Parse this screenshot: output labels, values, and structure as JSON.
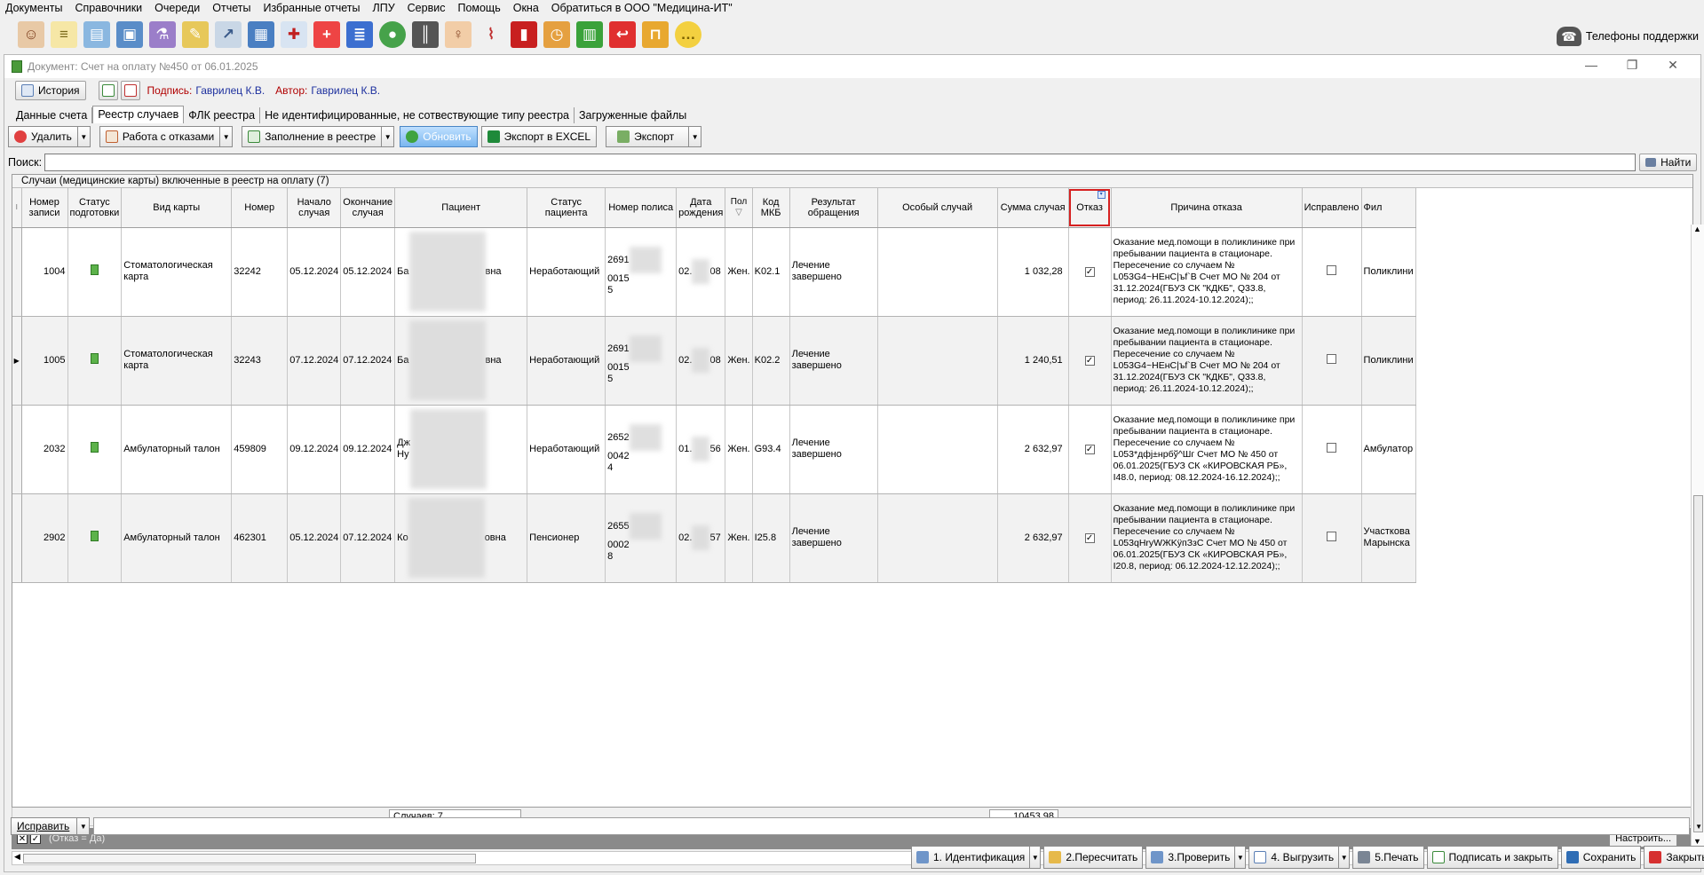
{
  "menu": [
    "Документы",
    "Справочники",
    "Очереди",
    "Отчеты",
    "Избранные отчеты",
    "ЛПУ",
    "Сервис",
    "Помощь",
    "Окна",
    "Обратиться в ООО \"Медицина-ИТ\""
  ],
  "toolbar": {
    "icons": [
      "doctor-icon",
      "notepad-icon",
      "card-index-icon",
      "id-card-icon",
      "lab-flask-icon",
      "pencil-note-icon",
      "syringe-icon",
      "calendar-icon",
      "ambulance-icon",
      "first-aid-icon",
      "books-icon",
      "globe-icon",
      "barcode-scanner-icon",
      "nurse-icon",
      "thermometer-icon",
      "red-book-icon",
      "schedule-icon",
      "green-lock-icon",
      "exit-icon",
      "padlock-icon",
      "chat-bubble-icon"
    ],
    "support_label": "Телефоны поддержки"
  },
  "window": {
    "title": "Документ: Счет на оплату №450 от 06.01.2025",
    "history_label": "История",
    "sign_label": "Подпись:",
    "sign_value": "Гаврилец К.В.",
    "author_label": "Автор:",
    "author_value": "Гаврилец К.В."
  },
  "tabs": [
    "Данные счета",
    "Реестр случаев",
    "ФЛК реестра",
    "Не идентифицированные, не сотвествующие типу реестра",
    "Загруженные файлы"
  ],
  "active_tab": "Реестр случаев",
  "actions": {
    "delete": "Удалить",
    "refusals": "Работа с отказами",
    "fill": "Заполнение в реестре",
    "refresh": "Обновить",
    "excel": "Экспорт в EXCEL",
    "export": "Экспорт"
  },
  "search": {
    "label": "Поиск:",
    "value": "",
    "find": "Найти"
  },
  "grid": {
    "caption": "Случаи (медицинские карты) включенные в реестр на оплату (7)",
    "headers": [
      "Номер записи",
      "Статус подготовки",
      "Вид карты",
      "Номер",
      "Начало случая",
      "Окончание случая",
      "Пациент",
      "Статус пациента",
      "Номер полиса",
      "Дата рождения",
      "Пол",
      "Код МКБ",
      "Результат обращения",
      "Особый случай",
      "Сумма случая",
      "Отказ",
      "Причина отказа",
      "Исправлено",
      "Фил"
    ],
    "rows": [
      {
        "rec": "1004",
        "kind": "Стоматологическая карта",
        "number": "32242",
        "start": "05.12.2024",
        "end": "05.12.2024",
        "patient_a": "Ба",
        "patient_b": "вна",
        "patient_status": "Неработающий",
        "policy_a": "2691",
        "policy_b": "0015",
        "policy_c": "5",
        "dob_a": "02.",
        "dob_b": "08",
        "sex": "Жен.",
        "mkb": "K02.1",
        "result": "Лечение завершено",
        "special": "",
        "sum": "1 032,28",
        "refusal": true,
        "reason": "Оказание мед.помощи в поликлинике при пребывании пациента в стационаре.\nПересечение со случаем № L053G4~HEнC|ъf`B Счет МО № 204 от 31.12.2024(ГБУЗ СК \"КДКБ\", Q33.8, период: 26.11.2024-10.12.2024);;",
        "fixed": false,
        "branch": "Поликлини"
      },
      {
        "rec": "1005",
        "kind": "Стоматологическая карта",
        "number": "32243",
        "start": "07.12.2024",
        "end": "07.12.2024",
        "patient_a": "Ба",
        "patient_b": "вна",
        "patient_status": "Неработающий",
        "policy_a": "2691",
        "policy_b": "0015",
        "policy_c": "5",
        "dob_a": "02.",
        "dob_b": "08",
        "sex": "Жен.",
        "mkb": "K02.2",
        "result": "Лечение завершено",
        "special": "",
        "sum": "1 240,51",
        "refusal": true,
        "reason": "Оказание мед.помощи в поликлинике при пребывании пациента в стационаре.\nПересечение со случаем № L053G4~HEнC|ъf`B Счет МО № 204 от 31.12.2024(ГБУЗ СК \"КДКБ\", Q33.8, период: 26.11.2024-10.12.2024);;",
        "fixed": false,
        "branch": "Поликлини"
      },
      {
        "rec": "2032",
        "kind": "Амбулаторный талон",
        "number": "459809",
        "start": "09.12.2024",
        "end": "09.12.2024",
        "patient_a": "Дж\nНу",
        "patient_b": "",
        "patient_status": "Неработающий",
        "policy_a": "2652",
        "policy_b": "0042",
        "policy_c": "4",
        "dob_a": "01.",
        "dob_b": "56",
        "sex": "Жен.",
        "mkb": "G93.4",
        "result": "Лечение завершено",
        "special": "",
        "sum": "2 632,97",
        "refusal": true,
        "reason": "Оказание мед.помощи в поликлинике при пребывании пациента в стационаре.\nПересечение со случаем № L053*дфj±нрбў^Шг Счет МО № 450 от 06.01.2025(ГБУЗ СК «КИРОВСКАЯ РБ», I48.0, период: 08.12.2024-16.12.2024);;",
        "fixed": false,
        "branch": "Амбулатор"
      },
      {
        "rec": "2902",
        "kind": "Амбулаторный талон",
        "number": "462301",
        "start": "05.12.2024",
        "end": "07.12.2024",
        "patient_a": "Ко",
        "patient_b": "овна",
        "patient_status": "Пенсионер",
        "policy_a": "2655",
        "policy_b": "0002",
        "policy_c": "8",
        "dob_a": "02.",
        "dob_b": "57",
        "sex": "Жен.",
        "mkb": "I25.8",
        "result": "Лечение завершено",
        "special": "",
        "sum": "2 632,97",
        "refusal": true,
        "reason": "Оказание мед.помощи в поликлинике при пребывании пациента в стационаре.\nПересечение со случаем № L053qHryWЖKÿпЗзС Счет МО № 450 от 06.01.2025(ГБУЗ СК «КИРОВСКАЯ РБ», I20.8, период: 06.12.2024-12.12.2024);;",
        "fixed": false,
        "branch": "Участкова\nМарынска"
      }
    ],
    "footer_count": "Случаев: 7",
    "footer_sum": "10453,98"
  },
  "filter": {
    "text": "(Отказ = Да)",
    "configure": "Настроить..."
  },
  "fix_button": "Исправить",
  "bottom": [
    "1. Идентификация",
    "2.Пересчитать",
    "3.Проверить",
    "4. Выгрузить",
    "5.Печать",
    "Подписать и закрыть",
    "Сохранить",
    "Закрыть"
  ],
  "colors": {
    "accent_blue": "#7ab6ef",
    "filter_bar": "#8a8a8a",
    "highlight_red": "#d62020",
    "link_blue": "#1c2f9e",
    "label_red": "#b00000"
  }
}
